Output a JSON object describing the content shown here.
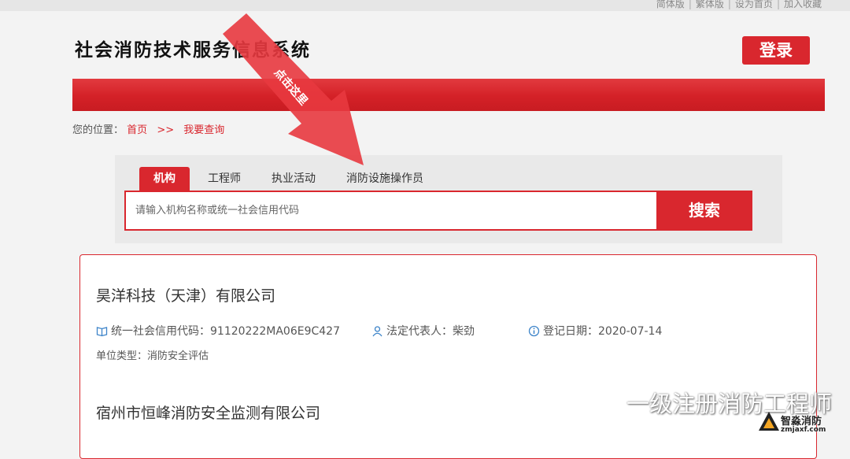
{
  "top_links": [
    "简体版",
    "繁体版",
    "设为首页",
    "加入收藏"
  ],
  "header": {
    "title": "社会消防技术服务信息系统",
    "login_label": "登录"
  },
  "breadcrumb": {
    "prefix": "您的位置：",
    "home": "首页",
    "separator": ">>",
    "current": "我要查询"
  },
  "annotation": {
    "text": "点击这里"
  },
  "search": {
    "tabs": [
      {
        "label": "机构",
        "active": true
      },
      {
        "label": "工程师",
        "active": false
      },
      {
        "label": "执业活动",
        "active": false
      },
      {
        "label": "消防设施操作员",
        "active": false
      }
    ],
    "placeholder": "请输入机构名称或统一社会信用代码",
    "value": "",
    "button_label": "搜索"
  },
  "results": [
    {
      "name": "昊洋科技（天津）有限公司",
      "credit_code": "统一社会信用代码：91120222MA06E9C427",
      "legal_rep": "法定代表人：柴劲",
      "reg_date": "登记日期：2020-07-14",
      "unit_type": "单位类型：消防安全评估"
    },
    {
      "name": "宿州市恒峰消防安全监测有限公司"
    }
  ],
  "watermark": {
    "text": "一级注册消防工程师",
    "brand": "智淼消防",
    "url": "zmjaxf.com"
  },
  "colors": {
    "accent": "#d9272e",
    "background": "#f3f3f3",
    "panel": "#e9e9e9"
  }
}
